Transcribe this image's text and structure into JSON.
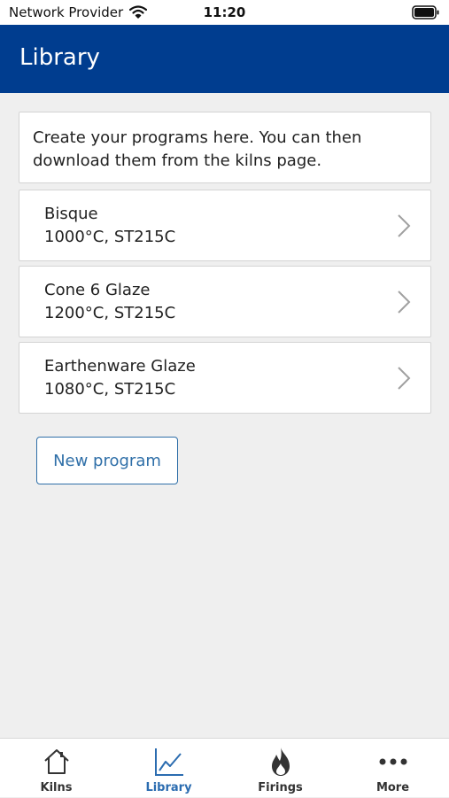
{
  "status_bar": {
    "carrier": "Network Provider",
    "time": "11:20"
  },
  "header": {
    "title": "Library"
  },
  "info": {
    "text": "Create your programs here. You can then download them from the kilns page."
  },
  "programs": [
    {
      "name": "Bisque",
      "details": "1000°C, ST215C"
    },
    {
      "name": "Cone 6 Glaze",
      "details": "1200°C, ST215C"
    },
    {
      "name": "Earthenware Glaze",
      "details": "1080°C, ST215C"
    }
  ],
  "actions": {
    "new_program_label": "New program"
  },
  "tab_bar": {
    "active": "Library",
    "tabs": [
      {
        "label": "Kilns",
        "icon": "home-icon"
      },
      {
        "label": "Library",
        "icon": "chart-line-icon"
      },
      {
        "label": "Firings",
        "icon": "flame-icon"
      },
      {
        "label": "More",
        "icon": "more-dots-icon"
      }
    ]
  },
  "colors": {
    "header_bg": "#003d8f",
    "accent": "#2f6fa8",
    "page_bg": "#efefef"
  }
}
